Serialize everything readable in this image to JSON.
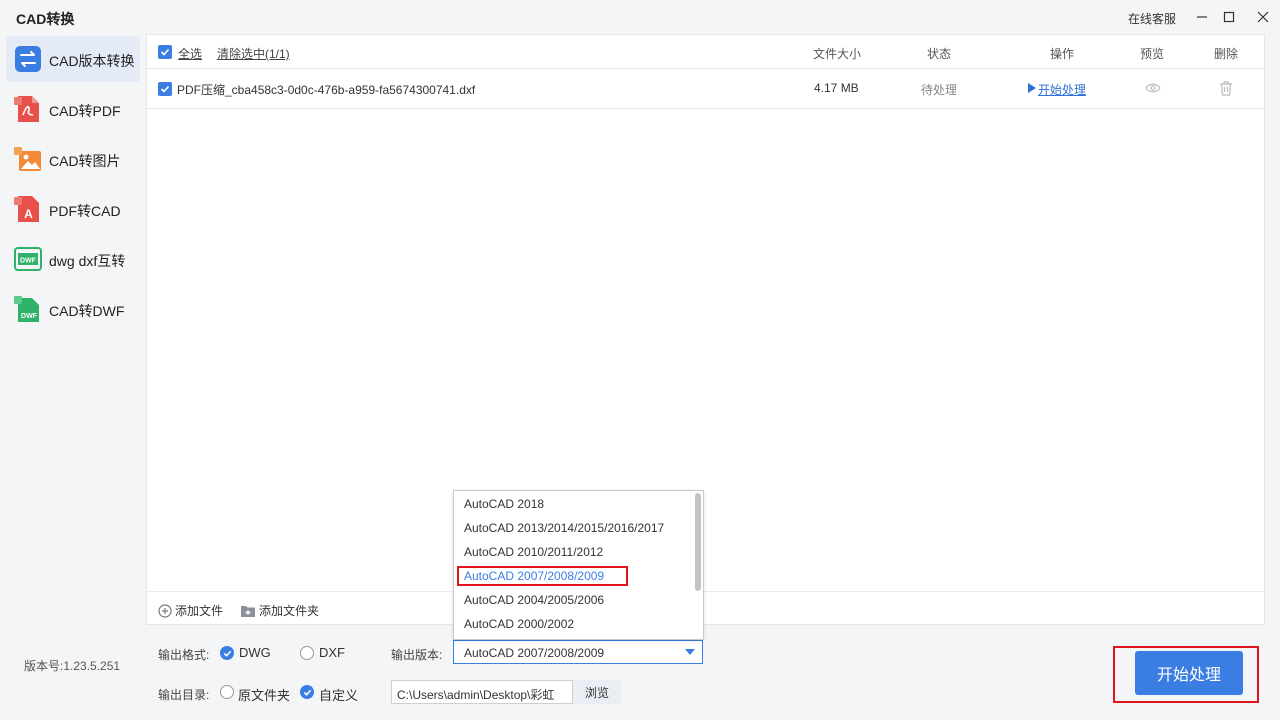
{
  "app": {
    "title": "CAD转换",
    "service": "在线客服",
    "version": "版本号:1.23.5.251"
  },
  "colors": {
    "accent": "#3a7ee4",
    "highlight": "#e0141e",
    "sidebar_active": "#e4ebf7"
  },
  "sidebar": {
    "items": [
      {
        "label": "CAD版本转换",
        "icon": "version-convert-icon",
        "active": true
      },
      {
        "label": "CAD转PDF",
        "icon": "pdf-icon"
      },
      {
        "label": "CAD转图片",
        "icon": "image-icon"
      },
      {
        "label": "PDF转CAD",
        "icon": "pdf-to-cad-icon"
      },
      {
        "label": "dwg dxf互转",
        "icon": "dwg-icon"
      },
      {
        "label": "CAD转DWF",
        "icon": "dwf-icon"
      }
    ]
  },
  "table": {
    "select_all": "全选",
    "clear_selected": "清除选中(1/1)",
    "columns": {
      "size": "文件大小",
      "status": "状态",
      "action": "操作",
      "preview": "预览",
      "delete": "删除"
    },
    "rows": [
      {
        "name": "PDF压缩_cba458c3-0d0c-476b-a959-fa5674300741.dxf",
        "size": "4.17 MB",
        "status": "待处理",
        "action": "开始处理"
      }
    ]
  },
  "footer": {
    "add_file": "添加文件",
    "add_folder": "添加文件夹"
  },
  "options": {
    "format_label": "输出格式:",
    "format_dwg": "DWG",
    "format_dxf": "DXF",
    "version_label": "输出版本:",
    "version_selected": "AutoCAD 2007/2008/2009",
    "version_options": [
      "AutoCAD 2018",
      "AutoCAD 2013/2014/2015/2016/2017",
      "AutoCAD 2010/2011/2012",
      "AutoCAD 2007/2008/2009",
      "AutoCAD 2004/2005/2006",
      "AutoCAD 2000/2002"
    ],
    "dir_label": "输出目录:",
    "dir_original": "原文件夹",
    "dir_custom": "自定义",
    "path": "C:\\Users\\admin\\Desktop\\彩虹",
    "browse": "浏览"
  },
  "start_button": "开始处理"
}
